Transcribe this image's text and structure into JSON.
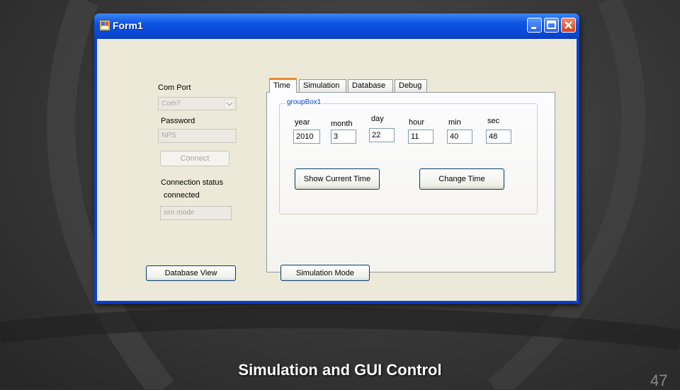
{
  "window": {
    "title": "Form1"
  },
  "left_panel": {
    "com_port_label": "Com Port",
    "com_port_value": "Com7",
    "password_label": "Password",
    "password_value": "NPS",
    "connect_label": "Connect",
    "connection_status_label": "Connection status",
    "connection_status_value": "connected",
    "mode_value": "sim mode"
  },
  "tabs": [
    {
      "label": "Time",
      "active": true
    },
    {
      "label": "Simulation",
      "active": false
    },
    {
      "label": "Database",
      "active": false
    },
    {
      "label": "Debug",
      "active": false
    }
  ],
  "groupbox": {
    "title": "groupBox1",
    "fields": [
      {
        "label": "year",
        "value": "2010"
      },
      {
        "label": "month",
        "value": "3"
      },
      {
        "label": "day",
        "value": "22"
      },
      {
        "label": "hour",
        "value": "11"
      },
      {
        "label": "min",
        "value": "40"
      },
      {
        "label": "sec",
        "value": "48"
      }
    ],
    "show_current_time_label": "Show Current Time",
    "change_time_label": "Change Time"
  },
  "bottom_buttons": {
    "database_view_label": "Database View",
    "simulation_mode_label": "Simulation Mode"
  },
  "slide": {
    "title": "Simulation and GUI Control",
    "page_number": "47"
  },
  "colors": {
    "titlebar": "#0b53e3",
    "client": "#ece9d8",
    "tab_highlight": "#e68b2c",
    "groupbox_title": "#0046d5"
  }
}
